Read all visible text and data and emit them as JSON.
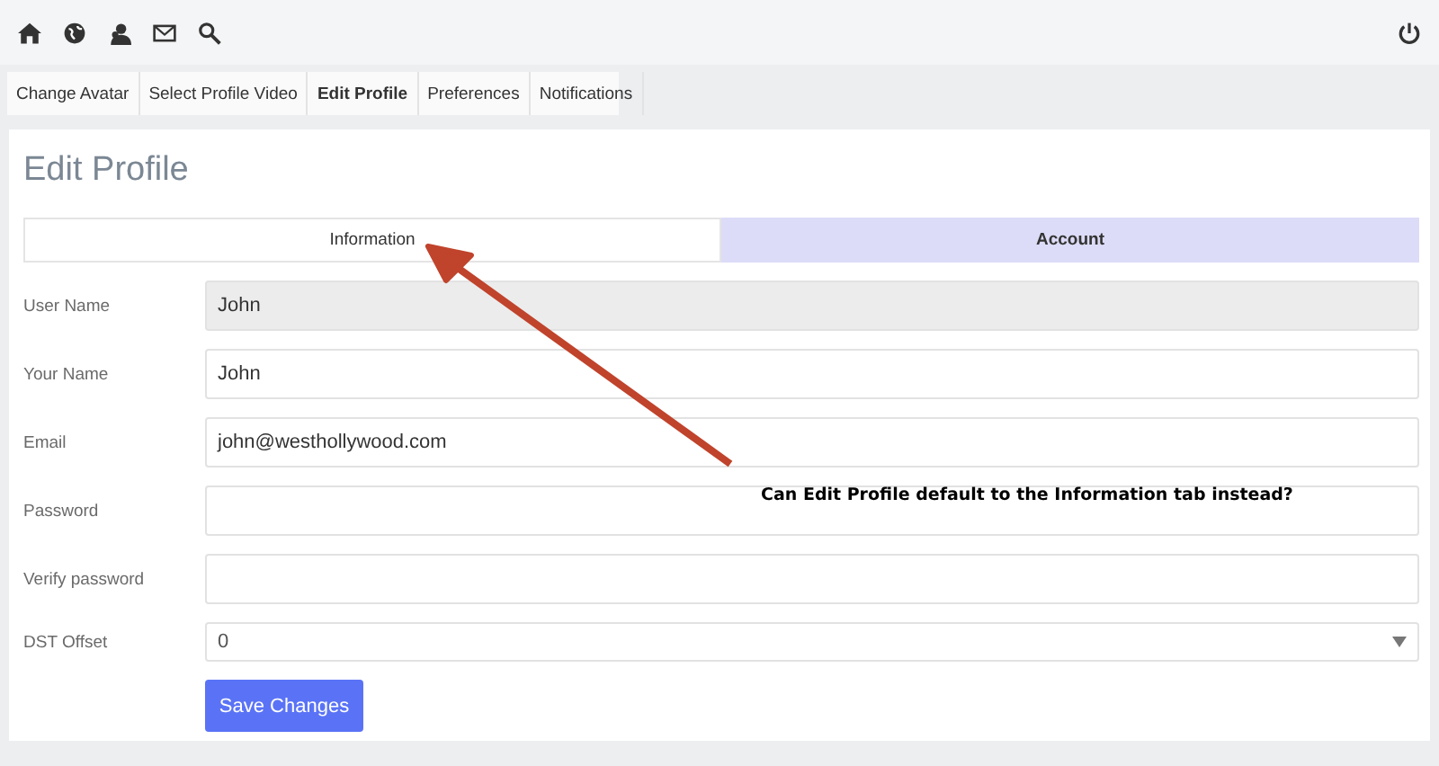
{
  "nav_tabs": [
    {
      "label": "Change Avatar",
      "selected": false
    },
    {
      "label": "Select Profile Video",
      "selected": false
    },
    {
      "label": "Edit Profile",
      "selected": true
    },
    {
      "label": "Preferences",
      "selected": false
    },
    {
      "label": "Notifications",
      "selected": false
    }
  ],
  "page_title": "Edit Profile",
  "section_tabs": [
    {
      "label": "Information",
      "selected": false
    },
    {
      "label": "Account",
      "selected": true
    }
  ],
  "fields": [
    {
      "kind": "text",
      "label": "User Name",
      "value": "John",
      "disabled": true
    },
    {
      "kind": "text",
      "label": "Your Name",
      "value": "John",
      "disabled": false
    },
    {
      "kind": "text",
      "label": "Email",
      "value": "john@westhollywood.com",
      "disabled": false
    },
    {
      "kind": "text",
      "label": "Password",
      "disabled": false
    },
    {
      "kind": "text",
      "label": "Verify password",
      "disabled": false
    },
    {
      "kind": "select",
      "label": "DST Offset",
      "value": "0",
      "disabled": false
    }
  ],
  "save_button": "Save Changes",
  "annotation": {
    "note": "Can Edit Profile default to the Information tab instead?"
  }
}
